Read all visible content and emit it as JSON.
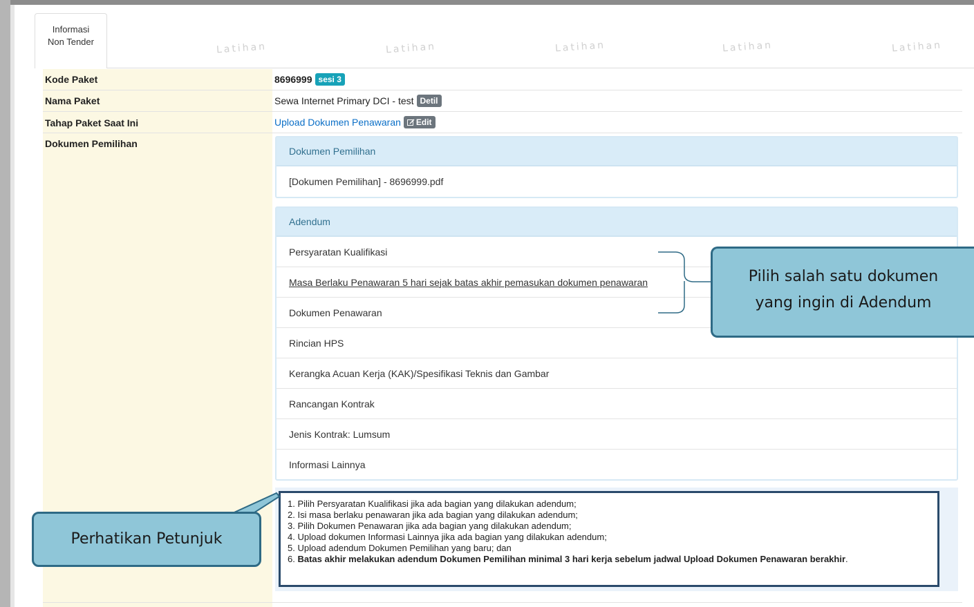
{
  "tab": {
    "line1": "Informasi",
    "line2": "Non Tender"
  },
  "watermark": "Latihan",
  "rows": {
    "kode_label": "Kode Paket",
    "kode_value": "8696999",
    "kode_badge": "sesi 3",
    "nama_label": "Nama Paket",
    "nama_value": "Sewa Internet Primary DCI - test",
    "nama_badge": "Detil",
    "tahap_label": "Tahap Paket Saat Ini",
    "tahap_value": "Upload Dokumen Penawaran",
    "tahap_badge": "Edit",
    "dok_label": "Dokumen Pemilihan"
  },
  "panel_dokumen": {
    "title": "Dokumen Pemilihan",
    "file": "[Dokumen Pemilihan] - 8696999.pdf"
  },
  "panel_adendum": {
    "title": "Adendum",
    "items": [
      "Persyaratan Kualifikasi",
      "Masa Berlaku Penawaran 5 hari sejak batas akhir pemasukan dokumen penawaran",
      "Dokumen Penawaran",
      "Rincian HPS",
      "Kerangka Acuan Kerja (KAK)/Spesifikasi Teknis dan Gambar",
      "Rancangan Kontrak",
      "Jenis Kontrak: Lumsum",
      "Informasi Lainnya"
    ]
  },
  "notes": {
    "n1": "1. Pilih Persyaratan Kualifikasi jika ada bagian yang dilakukan adendum;",
    "n2": "2. Isi masa berlaku penawaran jika ada bagian yang dilakukan adendum;",
    "n3": "3. Pilih Dokumen Penawaran jika ada bagian yang dilakukan adendum;",
    "n4": "4. Upload dokumen Informasi Lainnya jika ada bagian yang dilakukan adendum;",
    "n5": "5. Upload adendum Dokumen Pemilihan yang baru; dan",
    "n6_prefix": "6. ",
    "n6_bold": "Batas akhir melakukan adendum Dokumen Pemilihan minimal 3 hari kerja sebelum jadwal Upload Dokumen Penawaran berakhir",
    "n6_suffix": "."
  },
  "callouts": {
    "adendum_line1": "Pilih salah satu dokumen",
    "adendum_line2": "yang ingin di Adendum",
    "petunjuk": "Perhatikan Petunjuk"
  },
  "colors": {
    "label_bg": "#fcf8e3",
    "panel_head": "#d9ecf8",
    "link": "#0b6fc7",
    "badge_teal": "#17a2b8",
    "badge_grey": "#6c757d",
    "callout_fill": "#8fc6d8",
    "callout_border": "#2e6a85"
  }
}
